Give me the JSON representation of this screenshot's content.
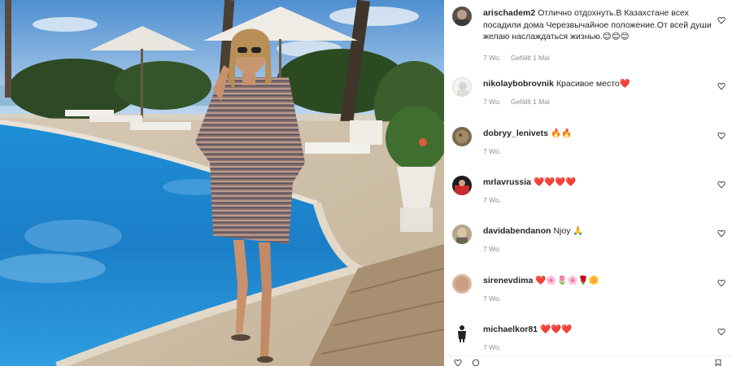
{
  "comments": [
    {
      "username": "arischadem2",
      "text": "Отлично отдохнуть.В Казахстане всех посадили дома Черезвычайное положение.От всей души желаю наслаждаться жизнью.😊😊😊",
      "age": "7 Wo.",
      "likes": "Gefällt 1 Mal"
    },
    {
      "username": "nikolaybobrovnik",
      "text": "Красивое место❤️",
      "age": "7 Wo.",
      "likes": "Gefällt 1 Mal"
    },
    {
      "username": "dobryy_lenivets",
      "text": "🔥🔥",
      "age": "7 Wo."
    },
    {
      "username": "mrlavrussia",
      "text": "❤️❤️❤️❤️",
      "age": "7 Wo."
    },
    {
      "username": "davidabendanon",
      "text": "Njoy 🙏",
      "age": "7 Wo."
    },
    {
      "username": "sirenevdima",
      "text": "❤️🌸🌷🌸🌹🌼",
      "age": "7 Wo."
    },
    {
      "username": "michaelkor81",
      "text": "❤️❤️❤️",
      "age": "7 Wo."
    }
  ],
  "colors": {
    "text": "#262626",
    "secondary": "#8e8e8e",
    "heart_outline": "#262626"
  },
  "icons": {
    "like": "heart-outline-icon",
    "bottom_left": "heart-outline-icon",
    "bottom_mid": "comment-icon",
    "bottom_right": "bookmark-icon"
  }
}
